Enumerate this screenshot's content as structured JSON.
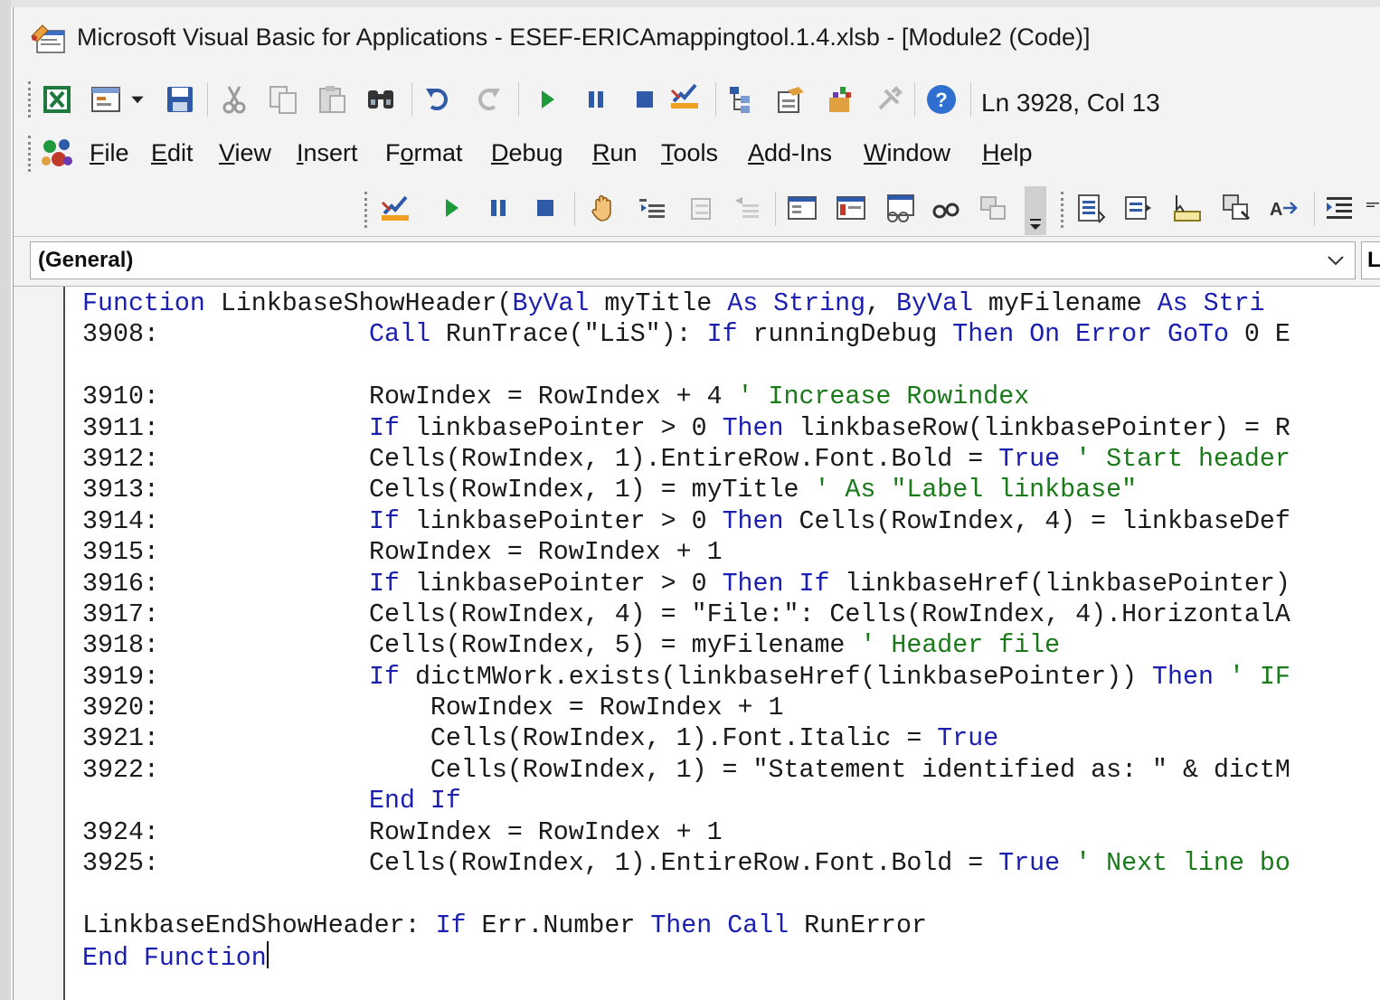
{
  "window": {
    "title": "Microsoft Visual Basic for Applications - ESEF-ERICAmappingtool.1.4.xlsb - [Module2 (Code)]"
  },
  "toolbar_standard": {
    "icons": [
      "view-excel-icon",
      "insert-userform-icon",
      "save-icon",
      "cut-icon",
      "copy-icon",
      "paste-icon",
      "find-icon",
      "undo-icon",
      "redo-icon",
      "run-icon",
      "break-icon",
      "reset-icon",
      "design-mode-icon",
      "project-explorer-icon",
      "properties-window-icon",
      "object-browser-icon",
      "toolbox-icon",
      "help-icon"
    ],
    "status": "Ln 3928, Col 13"
  },
  "menu": {
    "items": [
      {
        "label": "File",
        "u": "F",
        "rest": "ile"
      },
      {
        "label": "Edit",
        "u": "E",
        "rest": "dit"
      },
      {
        "label": "View",
        "u": "V",
        "rest": "iew"
      },
      {
        "label": "Insert",
        "u": "I",
        "rest": "nsert"
      },
      {
        "label": "Format",
        "pre": "F",
        "u": "o",
        "rest": "rmat"
      },
      {
        "label": "Debug",
        "u": "D",
        "rest": "ebug"
      },
      {
        "label": "Run",
        "u": "R",
        "rest": "un"
      },
      {
        "label": "Tools",
        "u": "T",
        "rest": "ools"
      },
      {
        "label": "Add-Ins",
        "u": "A",
        "rest": "dd-Ins"
      },
      {
        "label": "Window",
        "u": "W",
        "rest": "indow"
      },
      {
        "label": "Help",
        "u": "H",
        "rest": "elp"
      }
    ]
  },
  "procedure_bar": {
    "object": "(General)",
    "procedure": "L"
  },
  "code": {
    "lines": [
      [
        {
          "t": "Function",
          "k": 1
        },
        {
          "t": " LinkbaseShowHeader("
        },
        {
          "t": "ByVal",
          "k": 1
        },
        {
          "t": " myTitle "
        },
        {
          "t": "As String",
          "k": 1
        },
        {
          "t": ", "
        },
        {
          "t": "ByVal",
          "k": 1
        },
        {
          "t": " myFilename "
        },
        {
          "t": "As Stri",
          "k": 1
        }
      ],
      [
        {
          "n": "3908:"
        },
        {
          "t": "Call",
          "k": 1
        },
        {
          "t": " RunTrace(\"LiS\"): "
        },
        {
          "t": "If",
          "k": 1
        },
        {
          "t": " runningDebug "
        },
        {
          "t": "Then On Error GoTo",
          "k": 1
        },
        {
          "t": " 0 E"
        }
      ],
      [],
      [
        {
          "n": "3910:"
        },
        {
          "t": "RowIndex = RowIndex + 4 "
        },
        {
          "t": "' Increase Rowindex",
          "c": 1
        }
      ],
      [
        {
          "n": "3911:"
        },
        {
          "t": "If",
          "k": 1
        },
        {
          "t": " linkbasePointer > 0 "
        },
        {
          "t": "Then",
          "k": 1
        },
        {
          "t": " linkbaseRow(linkbasePointer) = R"
        }
      ],
      [
        {
          "n": "3912:"
        },
        {
          "t": "Cells(RowIndex, 1).EntireRow.Font.Bold = "
        },
        {
          "t": "True",
          "k": 1
        },
        {
          "t": " "
        },
        {
          "t": "' Start header",
          "c": 1
        }
      ],
      [
        {
          "n": "3913:"
        },
        {
          "t": "Cells(RowIndex, 1) = myTitle "
        },
        {
          "t": "' As \"Label linkbase\"",
          "c": 1
        }
      ],
      [
        {
          "n": "3914:"
        },
        {
          "t": "If",
          "k": 1
        },
        {
          "t": " linkbasePointer > 0 "
        },
        {
          "t": "Then",
          "k": 1
        },
        {
          "t": " Cells(RowIndex, 4) = linkbaseDef"
        }
      ],
      [
        {
          "n": "3915:"
        },
        {
          "t": "RowIndex = RowIndex + 1"
        }
      ],
      [
        {
          "n": "3916:"
        },
        {
          "t": "If",
          "k": 1
        },
        {
          "t": " linkbasePointer > 0 "
        },
        {
          "t": "Then If",
          "k": 1
        },
        {
          "t": " linkbaseHref(linkbasePointer)"
        }
      ],
      [
        {
          "n": "3917:"
        },
        {
          "t": "Cells(RowIndex, 4) = \"File:\": Cells(RowIndex, 4).HorizontalA"
        }
      ],
      [
        {
          "n": "3918:"
        },
        {
          "t": "Cells(RowIndex, 5) = myFilename "
        },
        {
          "t": "' Header file",
          "c": 1
        }
      ],
      [
        {
          "n": "3919:"
        },
        {
          "t": "If",
          "k": 1
        },
        {
          "t": " dictMWork.exists(linkbaseHref(linkbasePointer)) "
        },
        {
          "t": "Then",
          "k": 1
        },
        {
          "t": " "
        },
        {
          "t": "' IF",
          "c": 1
        }
      ],
      [
        {
          "n": "3920:"
        },
        {
          "t": "    RowIndex = RowIndex + 1"
        }
      ],
      [
        {
          "n": "3921:"
        },
        {
          "t": "    Cells(RowIndex, 1).Font.Italic = "
        },
        {
          "t": "True",
          "k": 1
        }
      ],
      [
        {
          "n": "3922:"
        },
        {
          "t": "    Cells(RowIndex, 1) = \"Statement identified as: \" & dictM"
        }
      ],
      [
        {
          "n": ""
        },
        {
          "t": "End If",
          "k": 1
        }
      ],
      [
        {
          "n": "3924:"
        },
        {
          "t": "RowIndex = RowIndex + 1"
        }
      ],
      [
        {
          "n": "3925:"
        },
        {
          "t": "Cells(RowIndex, 1).EntireRow.Font.Bold = "
        },
        {
          "t": "True",
          "k": 1
        },
        {
          "t": " "
        },
        {
          "t": "' Next line bo",
          "c": 1
        }
      ],
      [],
      [
        {
          "t": "LinkbaseEndShowHeader: "
        },
        {
          "t": "If",
          "k": 1
        },
        {
          "t": " Err.Number "
        },
        {
          "t": "Then Call",
          "k": 1
        },
        {
          "t": " RunError"
        }
      ],
      [
        {
          "t": "End Function",
          "k": 1
        },
        {
          "caret": 1
        }
      ]
    ]
  }
}
